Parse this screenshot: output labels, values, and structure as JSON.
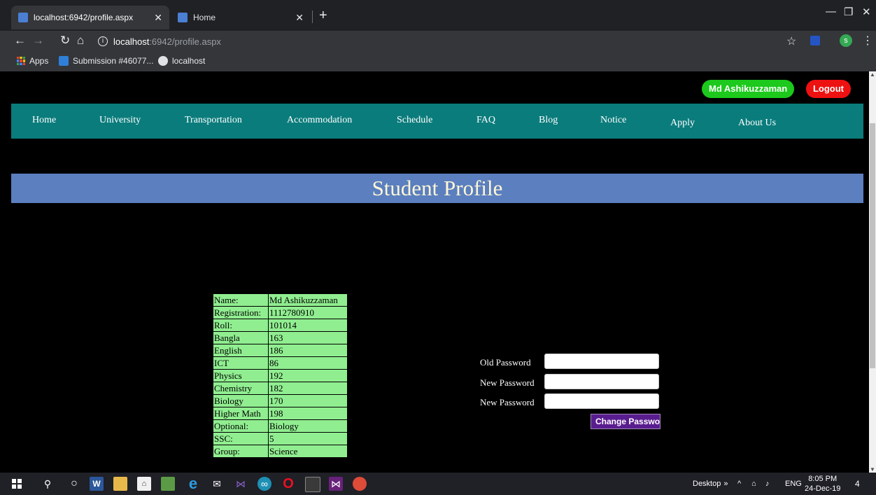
{
  "browser": {
    "tabs": [
      {
        "title": "localhost:6942/profile.aspx",
        "active": true
      },
      {
        "title": "Home",
        "active": false
      }
    ],
    "url_host": "localhost",
    "url_rest": ":6942/profile.aspx",
    "bookmarks": [
      {
        "label": "Apps"
      },
      {
        "label": "Submission #46077..."
      },
      {
        "label": "localhost"
      }
    ],
    "profile_initial": "s"
  },
  "header": {
    "user_name": "Md Ashikuzzaman",
    "logout_label": "Logout"
  },
  "nav": {
    "items": [
      "Home",
      "University",
      "Transportation",
      "Accommodation",
      "Schedule",
      "FAQ",
      "Blog",
      "Notice",
      "Apply",
      "About Us"
    ]
  },
  "banner": {
    "title": "Student Profile"
  },
  "profile": {
    "rows": [
      {
        "label": "Name:",
        "value": "Md Ashikuzzaman"
      },
      {
        "label": "Registration:",
        "value": "1112780910"
      },
      {
        "label": "Roll:",
        "value": "101014"
      },
      {
        "label": "Bangla",
        "value": "163"
      },
      {
        "label": "English",
        "value": "186"
      },
      {
        "label": "ICT",
        "value": "86"
      },
      {
        "label": "Physics",
        "value": "192"
      },
      {
        "label": "Chemistry",
        "value": "182"
      },
      {
        "label": "Biology",
        "value": "170"
      },
      {
        "label": "Higher Math",
        "value": "198"
      },
      {
        "label": "Optional:",
        "value": "Biology"
      },
      {
        "label": "SSC:",
        "value": "5"
      },
      {
        "label": "Group:",
        "value": "Science"
      }
    ]
  },
  "password_form": {
    "old_label": "Old Password",
    "new_label": "New Password",
    "confirm_label": "New Password",
    "old_value": "",
    "new_value": "",
    "confirm_value": "",
    "button_label": "Change Password"
  },
  "taskbar": {
    "desktop_label": "Desktop",
    "language": "ENG",
    "time": "8:05 PM",
    "date": "24-Dec-19",
    "notification_count": "4"
  }
}
